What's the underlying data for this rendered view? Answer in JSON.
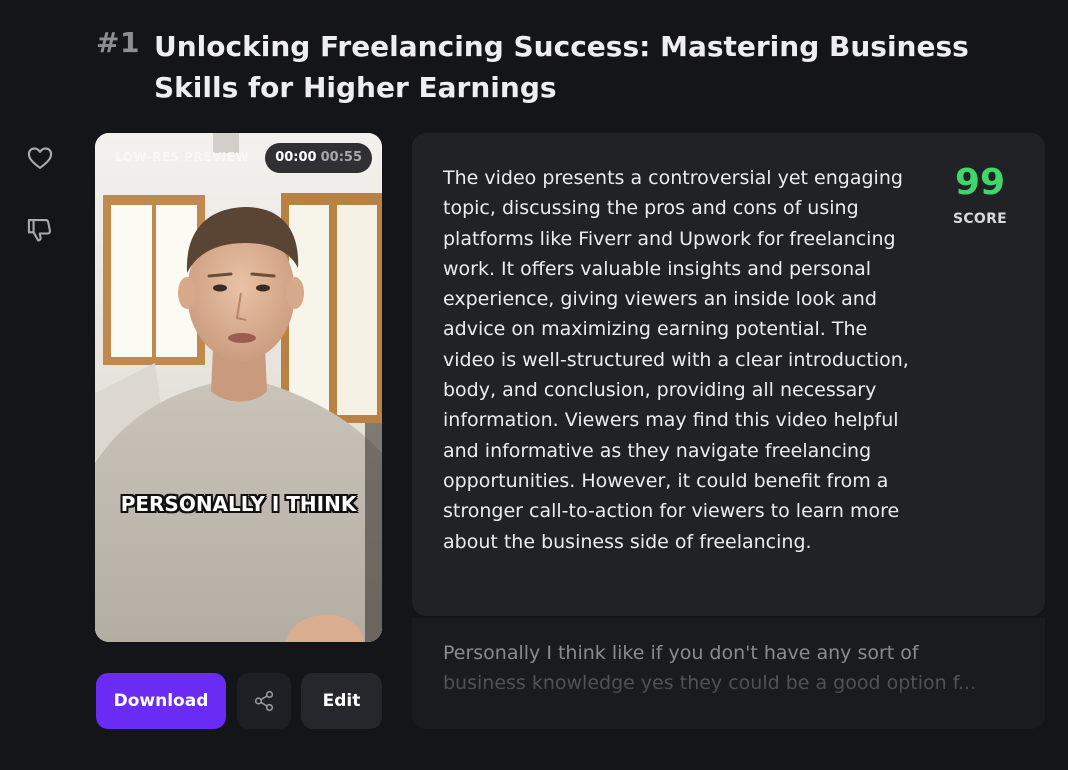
{
  "header": {
    "rank": "#1",
    "title": "Unlocking Freelancing Success: Mastering Business Skills for Higher Earnings"
  },
  "actions_sidebar": {
    "like_icon": "heart-icon",
    "dislike_icon": "thumbs-down-icon"
  },
  "video": {
    "preview_label": "LOW-RES PREVIEW",
    "current_time": "00:00",
    "duration": "00:55",
    "caption": "PERSONALLY I THINK"
  },
  "buttons": {
    "download_label": "Download",
    "share_icon": "share-icon",
    "edit_label": "Edit"
  },
  "analysis": {
    "description": "The video presents a controversial yet engaging topic, discussing the pros and cons of using platforms like Fiverr and Upwork for freelancing work. It offers valuable insights and personal experience, giving viewers an inside look and advice on maximizing earning potential. The video is well-structured with a clear introduction, body, and conclusion, providing all necessary information. Viewers may find this video helpful and informative as they navigate freelancing opportunities. However, it could benefit from a stronger call-to-action for viewers to learn more about the business side of freelancing.",
    "score_value": "99",
    "score_label": "SCORE",
    "score_color": "#3fd76a"
  },
  "transcript": {
    "line1": "Personally I think like if you don't have any sort of",
    "line2": "business knowledge yes they could be a good option f..."
  },
  "colors": {
    "background": "#141519",
    "primary_button": "#6a2cf5",
    "card": "#212226"
  }
}
